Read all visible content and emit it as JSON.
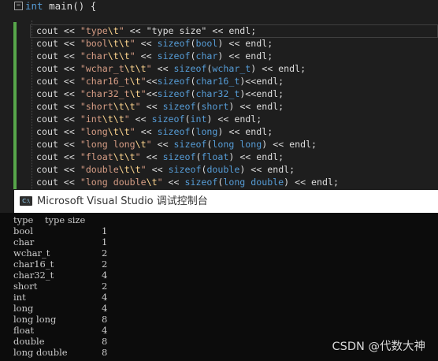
{
  "editor": {
    "collapse_glyph": "−",
    "func_keyword": "int",
    "func_rest": " main() {",
    "lines": [
      {
        "label": "\"type\\t\"",
        "rest": " << \"type size\" << endl;"
      },
      {
        "label": "\"bool\\t\\t\"",
        "rest": " << sizeof(bool) << endl;"
      },
      {
        "label": "\"char\\t\\t\"",
        "rest": " << sizeof(char) << endl;"
      },
      {
        "label": "\"wchar_t\\t\\t\"",
        "rest": " << sizeof(wchar_t) << endl;"
      },
      {
        "label": "\"char16_t\\t\"",
        "rest": "<<sizeof(char16_t)<<endl;"
      },
      {
        "label": "\"char32_t\\t\"",
        "rest": "<<sizeof(char32_t)<<endl;"
      },
      {
        "label": "\"short\\t\\t\"",
        "rest": " << sizeof(short) << endl;"
      },
      {
        "label": "\"int\\t\\t\"",
        "rest": " << sizeof(int) << endl;"
      },
      {
        "label": "\"long\\t\\t\"",
        "rest": " << sizeof(long) << endl;"
      },
      {
        "label": "\"long long\\t\"",
        "rest": " << sizeof(long long) << endl;"
      },
      {
        "label": "\"float\\t\\t\"",
        "rest": " << sizeof(float) << endl;"
      },
      {
        "label": "\"double\\t\\t\"",
        "rest": " << sizeof(double) << endl;"
      },
      {
        "label": "\"long double\\t\"",
        "rest": " << sizeof(long double) << endl;"
      }
    ]
  },
  "console": {
    "icon_text": "C:\\",
    "title": "Microsoft Visual Studio 调试控制台",
    "header": "type    type size",
    "rows": [
      {
        "type": "bool",
        "size": "1"
      },
      {
        "type": "char",
        "size": "1"
      },
      {
        "type": "wchar_t",
        "size": "2"
      },
      {
        "type": "char16_t",
        "size": "2"
      },
      {
        "type": "char32_t",
        "size": "4"
      },
      {
        "type": "short",
        "size": "2"
      },
      {
        "type": "int",
        "size": "4"
      },
      {
        "type": "long",
        "size": "4"
      },
      {
        "type": "long long",
        "size": "8"
      },
      {
        "type": "float",
        "size": "4"
      },
      {
        "type": "double",
        "size": "8"
      },
      {
        "type": "long double",
        "size": "8"
      }
    ]
  },
  "watermark": "CSDN @代数大神",
  "colors": {
    "editor_bg": "#1e1e1e",
    "keyword": "#569cd6",
    "string": "#d69d85",
    "escape": "#ffd68f",
    "change_bar": "#57a64a",
    "console_bg": "#0c0c0c",
    "console_text": "#cccccc"
  }
}
